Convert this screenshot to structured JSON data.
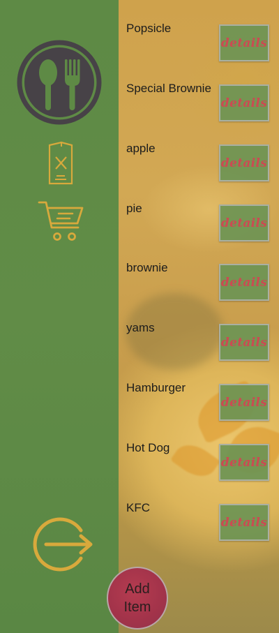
{
  "app": {
    "logo_icon": "spoon-fork-icon",
    "menu_icon": "menu-card-icon",
    "cart_icon": "cart-icon",
    "logout_icon": "logout-icon"
  },
  "items": [
    {
      "name": "Popsicle",
      "button": "details"
    },
    {
      "name": "Special Brownie",
      "button": "details"
    },
    {
      "name": "apple",
      "button": "details"
    },
    {
      "name": "pie",
      "button": "details"
    },
    {
      "name": "brownie",
      "button": "details"
    },
    {
      "name": "yams",
      "button": "details"
    },
    {
      "name": "Hamburger",
      "button": "details"
    },
    {
      "name": "Hot Dog",
      "button": "details"
    },
    {
      "name": "KFC",
      "button": "details"
    }
  ],
  "add_button": {
    "line1": "Add",
    "line2": "Item"
  },
  "colors": {
    "sidebar": "#5e8a45",
    "accent_icon": "#d8a93c",
    "details_text": "#cc4a52",
    "add_button": "#a2334a"
  }
}
